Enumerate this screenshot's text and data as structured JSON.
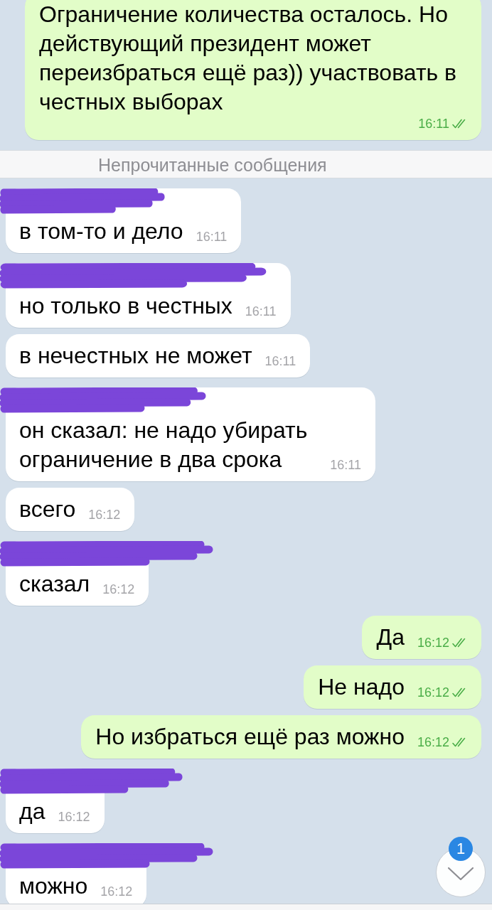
{
  "messages": [
    {
      "kind": "outgoing",
      "text": "Ограничение количества осталось. Но действующий президент может переизбраться ещё раз)) участвовать в честных выборах",
      "time": "16:11",
      "read": true
    },
    {
      "kind": "unread_divider",
      "text": "Непрочитанные сообщения"
    },
    {
      "kind": "incoming",
      "name_scribbled": true,
      "text": "в том-то и дело",
      "time": "16:11"
    },
    {
      "kind": "incoming",
      "name_scribbled": true,
      "text": "но только в честных",
      "time": "16:11"
    },
    {
      "kind": "incoming",
      "name_scribbled": false,
      "text": "в нечестных не может",
      "time": "16:11"
    },
    {
      "kind": "incoming",
      "name_scribbled": true,
      "text": "он сказал: не надо убирать ограничение в два срока",
      "time": "16:11"
    },
    {
      "kind": "incoming",
      "name_scribbled": false,
      "text": "всего",
      "time": "16:12"
    },
    {
      "kind": "incoming",
      "name_scribbled": true,
      "text": "сказал",
      "time": "16:12"
    },
    {
      "kind": "outgoing",
      "text": "Да",
      "time": "16:12",
      "read": true
    },
    {
      "kind": "outgoing",
      "text": "Не надо",
      "time": "16:12",
      "read": true
    },
    {
      "kind": "outgoing",
      "text": "Но избраться ещё раз можно",
      "time": "16:12",
      "read": true
    },
    {
      "kind": "incoming",
      "name_scribbled": true,
      "text": "да",
      "time": "16:12"
    },
    {
      "kind": "incoming",
      "name_scribbled": true,
      "text": "можно",
      "time": "16:12"
    }
  ],
  "scroll_down_button": {
    "unread_badge": "1"
  }
}
